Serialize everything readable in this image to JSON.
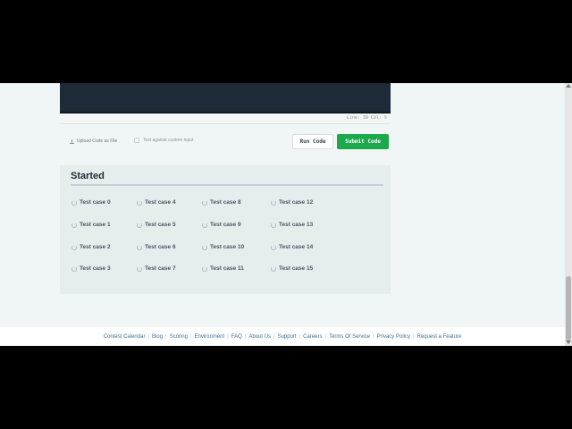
{
  "editor": {
    "status": "Line: 39 Col: 5"
  },
  "actions": {
    "upload_label": "Upload Code as File",
    "custom_input_label": "Test against custom input",
    "run_label": "Run Code",
    "submit_label": "Submit Code"
  },
  "results": {
    "title": "Started",
    "test_cases": [
      "Test case 0",
      "Test case 1",
      "Test case 2",
      "Test case 3",
      "Test case 4",
      "Test case 5",
      "Test case 6",
      "Test case 7",
      "Test case 8",
      "Test case 9",
      "Test case 10",
      "Test case 11",
      "Test case 12",
      "Test case 13",
      "Test case 14",
      "Test case 15"
    ]
  },
  "footer": {
    "links": [
      "Contest Calendar",
      "Blog",
      "Scoring",
      "Environment",
      "FAQ",
      "About Us",
      "Support",
      "Careers",
      "Terms Of Service",
      "Privacy Policy",
      "Request a Feature"
    ]
  },
  "colors": {
    "accent": "#1ba94c",
    "editor_bg": "#1e2a38",
    "link": "#39749a"
  }
}
